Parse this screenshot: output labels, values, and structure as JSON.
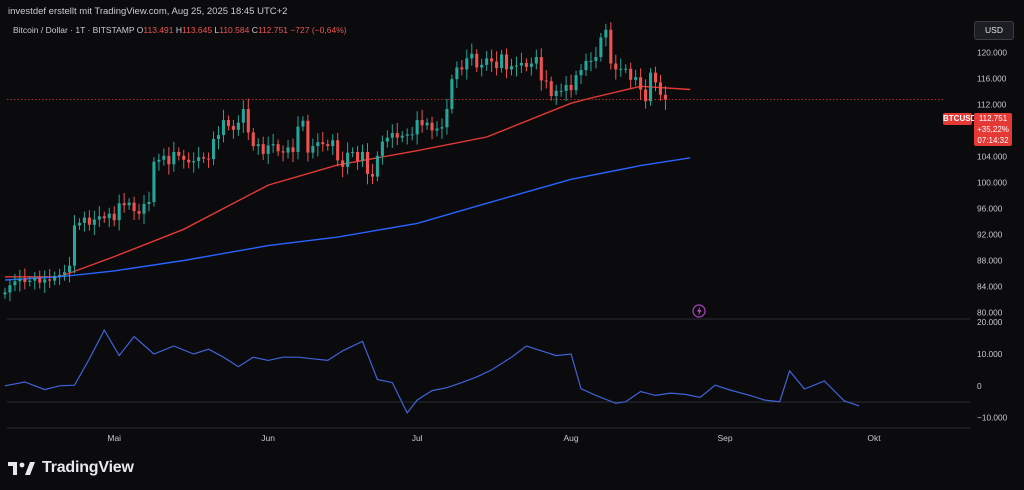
{
  "caption": "investdef erstellt mit TradingView.com, Aug 25, 2025 18:45 UTC+2",
  "legend": {
    "symbol": "Bitcoin / Dollar · 1T · BITSTAMP",
    "open_label": "O",
    "open": "113.491",
    "high_label": "H",
    "high": "113.645",
    "low_label": "L",
    "low": "110.584",
    "close_label": "C",
    "close": "112.751",
    "change": "−727 (−0,64%)"
  },
  "currency_button": "USD",
  "price_tag": {
    "symbol": "BTCUSD",
    "price": "112.751",
    "change_pct": "+35,22%",
    "countdown": "07:14:32"
  },
  "brand": {
    "name": "TradingView",
    "logo_icon": "tradingview-logo-icon"
  },
  "alert_icon": "lightning-alert-icon",
  "colors": {
    "up": "#26a69a",
    "down": "#ef5350",
    "ma_short": "#e53935",
    "ma_long": "#2962ff",
    "oscillator": "#3f63d8",
    "background": "#0b0b0d"
  },
  "chart_data": [
    {
      "type": "candlestick",
      "title": "Bitcoin / Dollar",
      "y_axis_labels": [
        "124.000",
        "120.000",
        "116.000",
        "112.000",
        "108.000",
        "104.000",
        "100.000",
        "96.000",
        "92.000",
        "88.000",
        "84.000",
        "80.000"
      ],
      "ylim": [
        79000,
        125000
      ],
      "x_tick_labels": [
        "Mai",
        "Jun",
        "Jul",
        "Aug",
        "Sep",
        "Okt"
      ],
      "x_tick_dates": [
        "2025-05-01",
        "2025-06-01",
        "2025-07-01",
        "2025-08-01",
        "2025-09-01",
        "2025-10-01"
      ],
      "xlim": [
        "2025-04-08",
        "2025-10-31"
      ],
      "grid": false,
      "candles": {
        "start_date": "2025-04-09",
        "close": [
          83100,
          84200,
          84800,
          85200,
          84700,
          84900,
          85300,
          84600,
          85100,
          84900,
          85600,
          85800,
          86200,
          87200,
          93400,
          93800,
          94600,
          93500,
          94300,
          94800,
          94500,
          95200,
          94200,
          96800,
          96500,
          96900,
          95600,
          95200,
          96700,
          97000,
          103200,
          103500,
          104100,
          102800,
          104700,
          104100,
          103500,
          103100,
          103300,
          103900,
          103700,
          103600,
          106700,
          107300,
          109600,
          108700,
          108100,
          109200,
          111300,
          107700,
          105600,
          105900,
          104400,
          105700,
          105900,
          104800,
          104600,
          105400,
          104700,
          108600,
          109500,
          104600,
          105600,
          106200,
          105900,
          105600,
          106500,
          103400,
          102400,
          104600,
          104700,
          103300,
          104700,
          101300,
          100900,
          104100,
          106300,
          106900,
          107600,
          106900,
          107200,
          107400,
          107400,
          109600,
          108800,
          109200,
          108000,
          108300,
          108500,
          111300,
          115900,
          117700,
          117400,
          119100,
          119800,
          117700,
          118100,
          119100,
          118600,
          117600,
          119700,
          117400,
          117900,
          118000,
          118400,
          117800,
          118300,
          119300,
          115700,
          115600,
          113300,
          114100,
          114100,
          115000,
          114200,
          116500,
          117300,
          118700,
          118700,
          119300,
          122300,
          123500,
          118300,
          117400,
          117500,
          117500,
          115800,
          116200,
          114300,
          112500,
          116900,
          115400,
          113500,
          112751
        ],
        "open": [
          82800,
          83100,
          84200,
          84800,
          85200,
          84700,
          84900,
          85300,
          84600,
          85100,
          84900,
          85600,
          85800,
          86200,
          87200,
          93400,
          93800,
          94600,
          93500,
          94300,
          94800,
          94500,
          95200,
          94200,
          96800,
          96500,
          96900,
          95600,
          95200,
          96700,
          97000,
          103200,
          103500,
          104100,
          102800,
          104700,
          104100,
          103500,
          103100,
          103300,
          103900,
          103700,
          103600,
          106700,
          107300,
          109600,
          108700,
          108100,
          109200,
          111300,
          107700,
          105600,
          105900,
          104400,
          105700,
          105900,
          104800,
          104600,
          105400,
          104700,
          108600,
          109500,
          104600,
          105600,
          106200,
          105900,
          105600,
          106500,
          103400,
          102400,
          104600,
          104700,
          103300,
          104700,
          101300,
          100900,
          104100,
          106300,
          106900,
          107600,
          106900,
          107200,
          107400,
          107400,
          109600,
          108800,
          109200,
          108000,
          108300,
          108500,
          111300,
          115900,
          117700,
          117400,
          119100,
          119800,
          117700,
          118100,
          119100,
          118600,
          117600,
          119700,
          117400,
          117900,
          118000,
          118400,
          117800,
          118300,
          119300,
          115700,
          115600,
          113300,
          114100,
          114100,
          115000,
          114200,
          116500,
          117300,
          118700,
          118700,
          119300,
          122300,
          123500,
          118300,
          117400,
          117500,
          117500,
          115800,
          116200,
          114300,
          112500,
          116900,
          115400,
          113491
        ]
      },
      "series": [
        {
          "name": "MA short",
          "color": "#e53935",
          "points": [
            [
              "2025-04-09",
              85500
            ],
            [
              "2025-04-20",
              85500
            ],
            [
              "2025-05-01",
              88600
            ],
            [
              "2025-05-15",
              92800
            ],
            [
              "2025-06-01",
              99600
            ],
            [
              "2025-06-15",
              102700
            ],
            [
              "2025-07-01",
              104900
            ],
            [
              "2025-07-15",
              107000
            ],
            [
              "2025-08-01",
              112200
            ],
            [
              "2025-08-05",
              113000
            ],
            [
              "2025-08-15",
              114800
            ],
            [
              "2025-08-25",
              114300
            ]
          ]
        },
        {
          "name": "MA long",
          "color": "#2962ff",
          "points": [
            [
              "2025-04-09",
              85000
            ],
            [
              "2025-04-20",
              85500
            ],
            [
              "2025-05-01",
              86400
            ],
            [
              "2025-05-15",
              88000
            ],
            [
              "2025-06-01",
              90300
            ],
            [
              "2025-06-15",
              91600
            ],
            [
              "2025-07-01",
              93700
            ],
            [
              "2025-07-15",
              96800
            ],
            [
              "2025-08-01",
              100500
            ],
            [
              "2025-08-15",
              102600
            ],
            [
              "2025-08-25",
              103800
            ]
          ]
        }
      ]
    },
    {
      "type": "line",
      "title": "",
      "y_axis_labels": [
        "20.000",
        "10.000",
        "0",
        "−10.000"
      ],
      "ylim": [
        -12000,
        21000
      ],
      "series": [
        {
          "name": "",
          "color": "#3f63d8",
          "points": [
            [
              "2025-04-09",
              0
            ],
            [
              "2025-04-13",
              1200
            ],
            [
              "2025-04-17",
              -1200
            ],
            [
              "2025-04-20",
              0
            ],
            [
              "2025-04-23",
              200
            ],
            [
              "2025-04-26",
              8500
            ],
            [
              "2025-04-29",
              17500
            ],
            [
              "2025-05-02",
              9500
            ],
            [
              "2025-05-05",
              15500
            ],
            [
              "2025-05-09",
              10000
            ],
            [
              "2025-05-13",
              12500
            ],
            [
              "2025-05-17",
              10000
            ],
            [
              "2025-05-20",
              11500
            ],
            [
              "2025-05-23",
              9000
            ],
            [
              "2025-05-26",
              6000
            ],
            [
              "2025-05-29",
              9000
            ],
            [
              "2025-06-01",
              8000
            ],
            [
              "2025-06-04",
              9000
            ],
            [
              "2025-06-07",
              9000
            ],
            [
              "2025-06-10",
              8500
            ],
            [
              "2025-06-13",
              8000
            ],
            [
              "2025-06-16",
              11000
            ],
            [
              "2025-06-20",
              14000
            ],
            [
              "2025-06-23",
              2000
            ],
            [
              "2025-06-26",
              1000
            ],
            [
              "2025-06-29",
              -8500
            ],
            [
              "2025-07-01",
              -4500
            ],
            [
              "2025-07-04",
              -1500
            ],
            [
              "2025-07-07",
              -600
            ],
            [
              "2025-07-10",
              1000
            ],
            [
              "2025-07-13",
              2800
            ],
            [
              "2025-07-16",
              5000
            ],
            [
              "2025-07-20",
              9000
            ],
            [
              "2025-07-23",
              12500
            ],
            [
              "2025-07-26",
              11000
            ],
            [
              "2025-07-29",
              9500
            ],
            [
              "2025-08-01",
              10000
            ],
            [
              "2025-08-03",
              -900
            ],
            [
              "2025-08-06",
              -3000
            ],
            [
              "2025-08-10",
              -5500
            ],
            [
              "2025-08-12",
              -5000
            ],
            [
              "2025-08-15",
              -1800
            ],
            [
              "2025-08-18",
              -3000
            ],
            [
              "2025-08-21",
              -2300
            ],
            [
              "2025-08-24",
              -2700
            ],
            [
              "2025-08-27",
              -3600
            ],
            [
              "2025-08-30",
              200
            ],
            [
              "2025-09-02",
              -1300
            ],
            [
              "2025-09-06",
              -3000
            ],
            [
              "2025-09-09",
              -4500
            ],
            [
              "2025-09-12",
              -5000
            ],
            [
              "2025-09-14",
              4700
            ],
            [
              "2025-09-17",
              -1000
            ],
            [
              "2025-09-21",
              1500
            ],
            [
              "2025-09-25",
              -4700
            ],
            [
              "2025-09-28",
              -6300
            ]
          ]
        }
      ]
    }
  ]
}
